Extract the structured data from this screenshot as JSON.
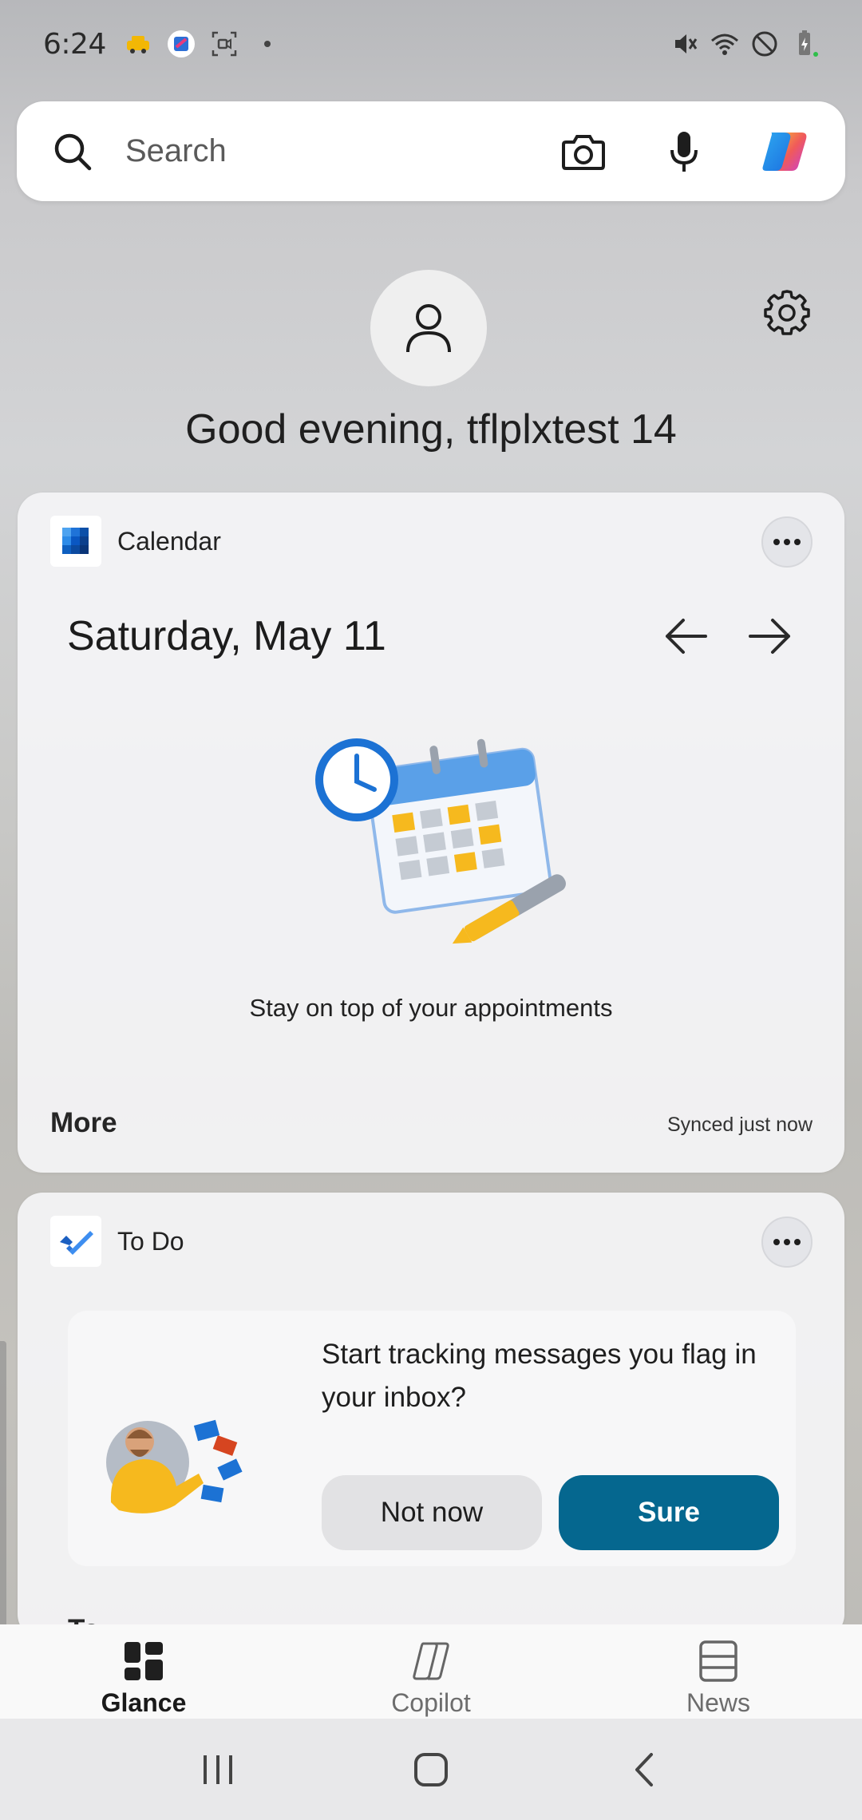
{
  "status_bar": {
    "time": "6:24"
  },
  "search": {
    "placeholder": "Search"
  },
  "profile": {
    "greeting": "Good evening, tflplxtest 14"
  },
  "calendar_card": {
    "title": "Calendar",
    "date": "Saturday, May 11",
    "empty_message": "Stay on top of your appointments",
    "more_label": "More",
    "sync_status": "Synced just now"
  },
  "todo_card": {
    "title": "To Do",
    "prompt": "Start tracking messages you flag in your inbox?",
    "not_now_label": "Not now",
    "sure_label": "Sure",
    "peek_text": "To"
  },
  "bottom_nav": {
    "tabs": [
      {
        "label": "Glance",
        "icon": "glance-icon",
        "active": true
      },
      {
        "label": "Copilot",
        "icon": "copilot-icon",
        "active": false
      },
      {
        "label": "News",
        "icon": "news-icon",
        "active": false
      }
    ]
  },
  "colors": {
    "accent": "#05678f",
    "card_bg": "#f4f4f6"
  }
}
